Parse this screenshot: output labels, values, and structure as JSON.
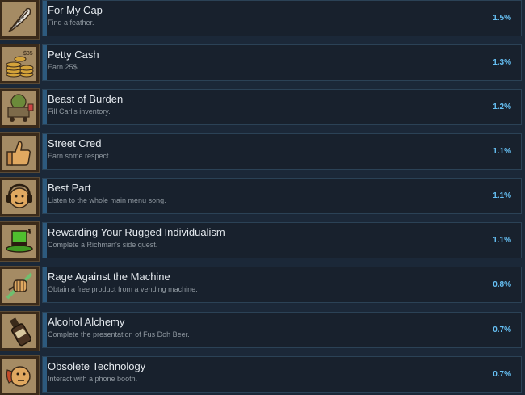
{
  "achievements": [
    {
      "title": "For My Cap",
      "description": "Find a feather.",
      "percent": "1.5%",
      "icon": "feather-icon",
      "progress": 0.0
    },
    {
      "title": "Petty Cash",
      "description": "Earn 25$.",
      "percent": "1.3%",
      "icon": "coin-stack-icon",
      "icon_label": "$35",
      "progress": 0.0
    },
    {
      "title": "Beast of Burden",
      "description": "Fill Carl's inventory.",
      "percent": "1.2%",
      "icon": "overloaded-cart-icon",
      "progress": 0.0
    },
    {
      "title": "Street Cred",
      "description": "Earn some respect.",
      "percent": "1.1%",
      "icon": "thumbs-up-icon",
      "progress": 0.0
    },
    {
      "title": "Best Part",
      "description": "Listen to the whole main menu song.",
      "percent": "1.1%",
      "icon": "headphones-face-icon",
      "progress": 0.0
    },
    {
      "title": "Rewarding Your Rugged Individualism",
      "description": "Complete a Richman's side quest.",
      "percent": "1.1%",
      "icon": "green-top-hat-icon",
      "progress": 0.0
    },
    {
      "title": "Rage Against the Machine",
      "description": "Obtain a free product from a vending machine.",
      "percent": "0.8%",
      "icon": "fist-punch-icon",
      "progress": 0.0
    },
    {
      "title": "Alcohol Alchemy",
      "description": "Complete the presentation of Fus Doh Beer.",
      "percent": "0.7%",
      "icon": "beer-bottle-icon",
      "progress": 0.0
    },
    {
      "title": "Obsolete Technology",
      "description": "Interact with a phone booth.",
      "percent": "0.7%",
      "icon": "phone-face-icon",
      "progress": 0.0
    }
  ],
  "colors": {
    "background": "#1b2838",
    "panel": "#18212d",
    "panel_border": "#2b4256",
    "progress_accent": "#2d5a7e",
    "percent_text": "#66c0f4",
    "title_text": "#e4e9ee",
    "description_text": "#8f98a0",
    "icon_background": "#a58b64",
    "icon_frame": "#3a2a1a"
  }
}
